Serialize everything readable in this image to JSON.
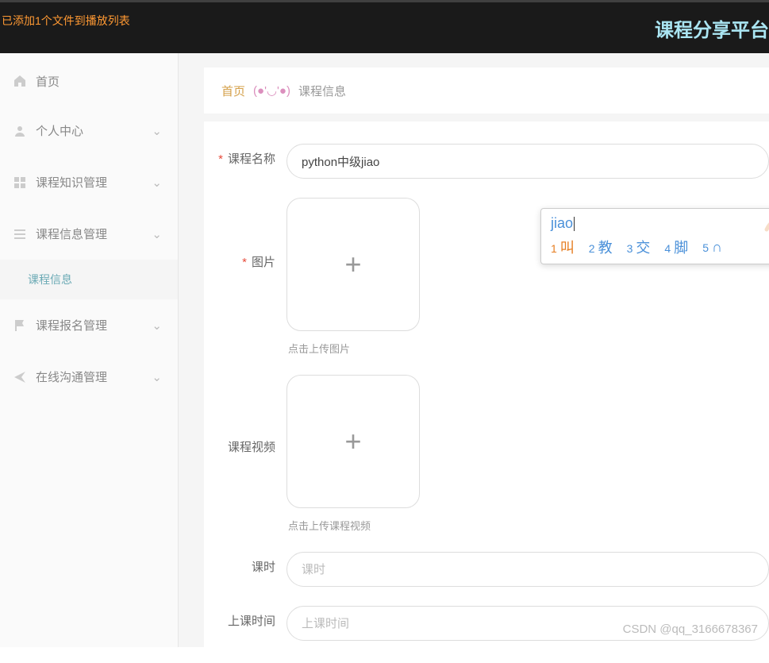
{
  "topbar": {
    "playlist_notice": "已添加1个文件到播放列表",
    "platform_title": "课程分享平台"
  },
  "sidebar": {
    "items": [
      {
        "label": "首页",
        "icon": "home-icon"
      },
      {
        "label": "个人中心",
        "icon": "user-icon"
      },
      {
        "label": "课程知识管理",
        "icon": "grid-icon"
      },
      {
        "label": "课程信息管理",
        "icon": "list-icon"
      },
      {
        "label": "课程报名管理",
        "icon": "flag-icon"
      },
      {
        "label": "在线沟通管理",
        "icon": "send-icon"
      }
    ],
    "sub_item_label": "课程信息"
  },
  "breadcrumb": {
    "home": "首页",
    "face": "(●'◡'●)",
    "current": "课程信息"
  },
  "form": {
    "course_name_label": "课程名称",
    "course_name_value": "python中级jiao",
    "image_label": "图片",
    "image_hint": "点击上传图片",
    "video_label": "课程视频",
    "video_hint": "点击上传课程视频",
    "duration_label": "课时",
    "duration_placeholder": "课时",
    "time_label": "上课时间",
    "time_placeholder": "上课时间"
  },
  "ime": {
    "input_text": "jiao",
    "candidates": [
      {
        "num": "1",
        "char": "叫"
      },
      {
        "num": "2",
        "char": "教"
      },
      {
        "num": "3",
        "char": "交"
      },
      {
        "num": "4",
        "char": "脚"
      },
      {
        "num": "5",
        "char": "∩"
      }
    ]
  },
  "watermark": "CSDN @qq_3166678367"
}
